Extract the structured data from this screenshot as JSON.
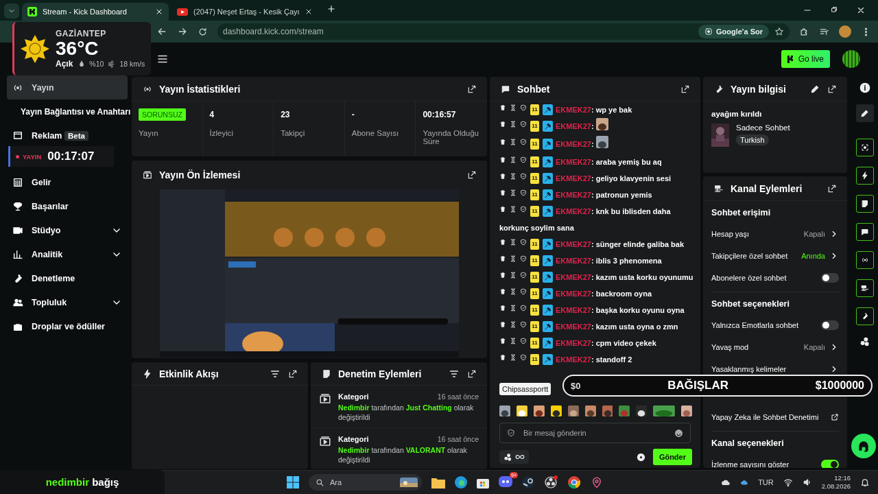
{
  "browser": {
    "tabs": [
      {
        "title": "Stream - Kick Dashboard",
        "selected": true
      },
      {
        "title": "(2047) Neşet Ertaş - Kesik Çayı",
        "selected": false
      }
    ],
    "url": "dashboard.kick.com/stream",
    "ask_button": "Google'a Sor"
  },
  "weather": {
    "city": "GAZİANTEP",
    "temperature": "36°C",
    "condition": "Açık",
    "humidity": "%10",
    "wind": "18 km/s"
  },
  "live_timer": {
    "label": "YAYIN",
    "time": "00:17:07"
  },
  "header": {
    "go_live": "Go live"
  },
  "sidebar": {
    "items": [
      {
        "label": "Yayın",
        "kind": "link",
        "selected": true
      },
      {
        "label": "Yayın Bağlantısı ve Anahtarı",
        "kind": "sub",
        "selected": false
      },
      {
        "label": "Reklam",
        "badge": "Beta",
        "kind": "link",
        "selected": false
      },
      {
        "label": "Gelir",
        "kind": "link",
        "selected": false
      },
      {
        "label": "Başarılar",
        "kind": "link",
        "selected": false
      },
      {
        "label": "Stüdyo",
        "kind": "group",
        "selected": false
      },
      {
        "label": "Analitik",
        "kind": "group",
        "selected": false
      },
      {
        "label": "Denetleme",
        "kind": "link",
        "selected": false
      },
      {
        "label": "Topluluk",
        "kind": "group",
        "selected": false
      },
      {
        "label": "Droplar ve ödüller",
        "kind": "link",
        "selected": false
      }
    ]
  },
  "stats": {
    "title": "Yayın İstatistikleri",
    "status_badge": "SORUNSUZ",
    "status_label": "Yayın",
    "metrics": [
      {
        "value": "4",
        "label": "İzleyici"
      },
      {
        "value": "23",
        "label": "Takipçi"
      },
      {
        "value": "-",
        "label": "Abone Sayısı"
      },
      {
        "value": "00:16:57",
        "label": "Yayında Olduğu Süre"
      }
    ]
  },
  "preview": {
    "title": "Yayın Ön İzlemesi",
    "kind": "picture"
  },
  "activity": {
    "title": "Etkinlik Akışı"
  },
  "moderation": {
    "title": "Denetim Eylemleri",
    "entries": [
      {
        "type": "Kategori",
        "time": "16 saat önce",
        "text": "**Nedimbir** tarafından **Just Chatting** olarak değiştirildi"
      },
      {
        "type": "Kategori",
        "time": "16 saat önce",
        "text": "**Nedimbir** tarafından **VALORANT** olarak değiştirildi"
      }
    ]
  },
  "chat": {
    "title": "Sohbet",
    "messages": [
      {
        "kind": "text",
        "badge": "11",
        "user": "EKMEK27",
        "sep": ":",
        "text": "wp ye bak"
      },
      {
        "kind": "emote",
        "badge": "11",
        "user": "EKMEK27",
        "sep": ":"
      },
      {
        "kind": "emote",
        "badge": "11",
        "user": "EKMEK27",
        "sep": ":"
      },
      {
        "kind": "text",
        "badge": "11",
        "user": "EKMEK27",
        "sep": ":",
        "text": "araba yemiş bu aq"
      },
      {
        "kind": "text",
        "badge": "11",
        "user": "EKMEK27",
        "sep": ":",
        "text": "geliyo klavyenin sesi"
      },
      {
        "kind": "text",
        "badge": "11",
        "user": "EKMEK27",
        "sep": ":",
        "text": "patronun yemis"
      },
      {
        "kind": "text",
        "badge": "11",
        "user": "EKMEK27",
        "sep": ":",
        "text": "knk bu iblisden daha korkunç soylim sana"
      },
      {
        "kind": "text",
        "badge": "11",
        "user": "EKMEK27",
        "sep": ":",
        "text": "sünger elinde galiba bak"
      },
      {
        "kind": "text",
        "badge": "11",
        "user": "EKMEK27",
        "sep": ":",
        "text": "iblis 3 phenomena"
      },
      {
        "kind": "text",
        "badge": "11",
        "user": "EKMEK27",
        "sep": ":",
        "text": "kazım usta korku oyunumu"
      },
      {
        "kind": "text",
        "badge": "11",
        "user": "EKMEK27",
        "sep": ":",
        "text": "backroom oyna"
      },
      {
        "kind": "text",
        "badge": "11",
        "user": "EKMEK27",
        "sep": ":",
        "text": "başka korku oyunu oyna"
      },
      {
        "kind": "text",
        "badge": "11",
        "user": "EKMEK27",
        "sep": ":",
        "text": "kazım usta oyna o zmn"
      },
      {
        "kind": "text",
        "badge": "11",
        "user": "EKMEK27",
        "sep": ":",
        "text": "cpm video çekek"
      },
      {
        "kind": "text",
        "badge": "11",
        "user": "EKMEK27",
        "sep": ":",
        "text": "standoff 2"
      }
    ],
    "emote_tooltip": "Chipsassportt",
    "placeholder": "Bir mesaj gönderin",
    "send": "Gönder"
  },
  "stream_info": {
    "title": "Yayın bilgisi",
    "stream_title": "ayağım kırıldı",
    "category": "Sadece Sohbet",
    "tag": "Turkish"
  },
  "channel_actions": {
    "title": "Kanal Eylemleri",
    "sections": [
      {
        "heading": "Sohbet erişimi",
        "rows": [
          {
            "kind": "value",
            "label": "Hesap yaşı",
            "value": "Kapalı",
            "highlight": false
          },
          {
            "kind": "value",
            "label": "Takipçilere özel sohbet",
            "value": "Anında",
            "highlight": true
          },
          {
            "kind": "toggle",
            "label": "Abonelere özel sohbet",
            "on": false
          }
        ]
      },
      {
        "heading": "Sohbet seçenekleri",
        "rows": [
          {
            "kind": "toggle",
            "label": "Yalnızca Emotlarla sohbet",
            "on": false
          },
          {
            "kind": "value",
            "label": "Yavaş mod",
            "value": "Kapalı",
            "highlight": false
          },
          {
            "kind": "nav",
            "label": "Yasaklanmış kelimeler"
          },
          {
            "kind": "link",
            "label": "Yapay Zeka ile Sohbet Denetimi"
          }
        ]
      },
      {
        "heading": "Kanal seçenekleri",
        "rows": [
          {
            "kind": "toggle",
            "label": "İzlenme sayısını göster",
            "on": true
          }
        ]
      }
    ]
  },
  "donation": {
    "current": "$0",
    "label": "BAĞIŞLAR",
    "goal": "$1000000"
  },
  "donor_box": {
    "text": "**nedimbir** bağış"
  },
  "taskbar": {
    "search": "Ara",
    "discord_badge": "9+",
    "language": "TUR",
    "time": "12:16",
    "date": "2.08.2026"
  }
}
